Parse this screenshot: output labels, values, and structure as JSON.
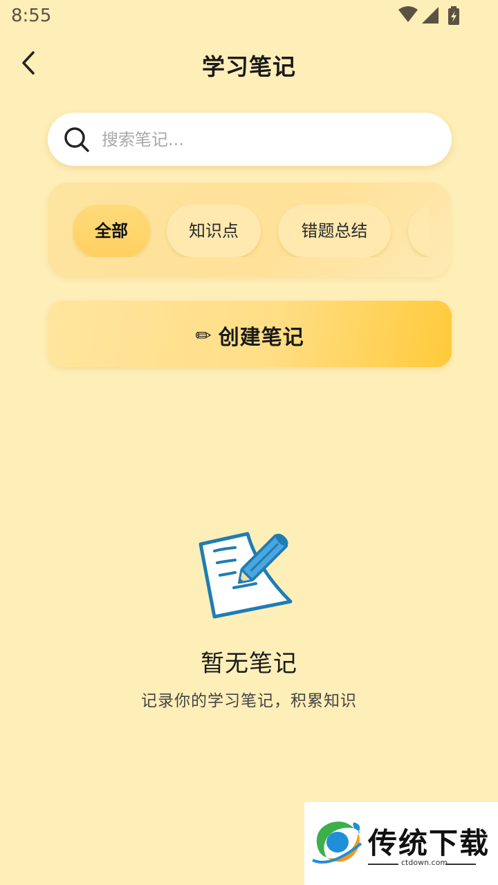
{
  "status_bar": {
    "time": "8:55"
  },
  "header": {
    "title": "学习笔记"
  },
  "search": {
    "placeholder": "搜索笔记..."
  },
  "filters": [
    {
      "label": "全部",
      "active": true
    },
    {
      "label": "知识点",
      "active": false
    },
    {
      "label": "错题总结",
      "active": false
    }
  ],
  "create_button": {
    "icon": "✏",
    "label": "创建笔记"
  },
  "empty_state": {
    "illustration": "note-pencil-icon",
    "title": "暂无笔记",
    "subtitle": "记录你的学习笔记，积累知识"
  },
  "watermark": {
    "title": "传统下载",
    "url": "ctdown.com"
  },
  "colors": {
    "background": "#FEEEB8",
    "accent": "#FFCA3A",
    "illustration_blue": "#1E7DB5"
  }
}
